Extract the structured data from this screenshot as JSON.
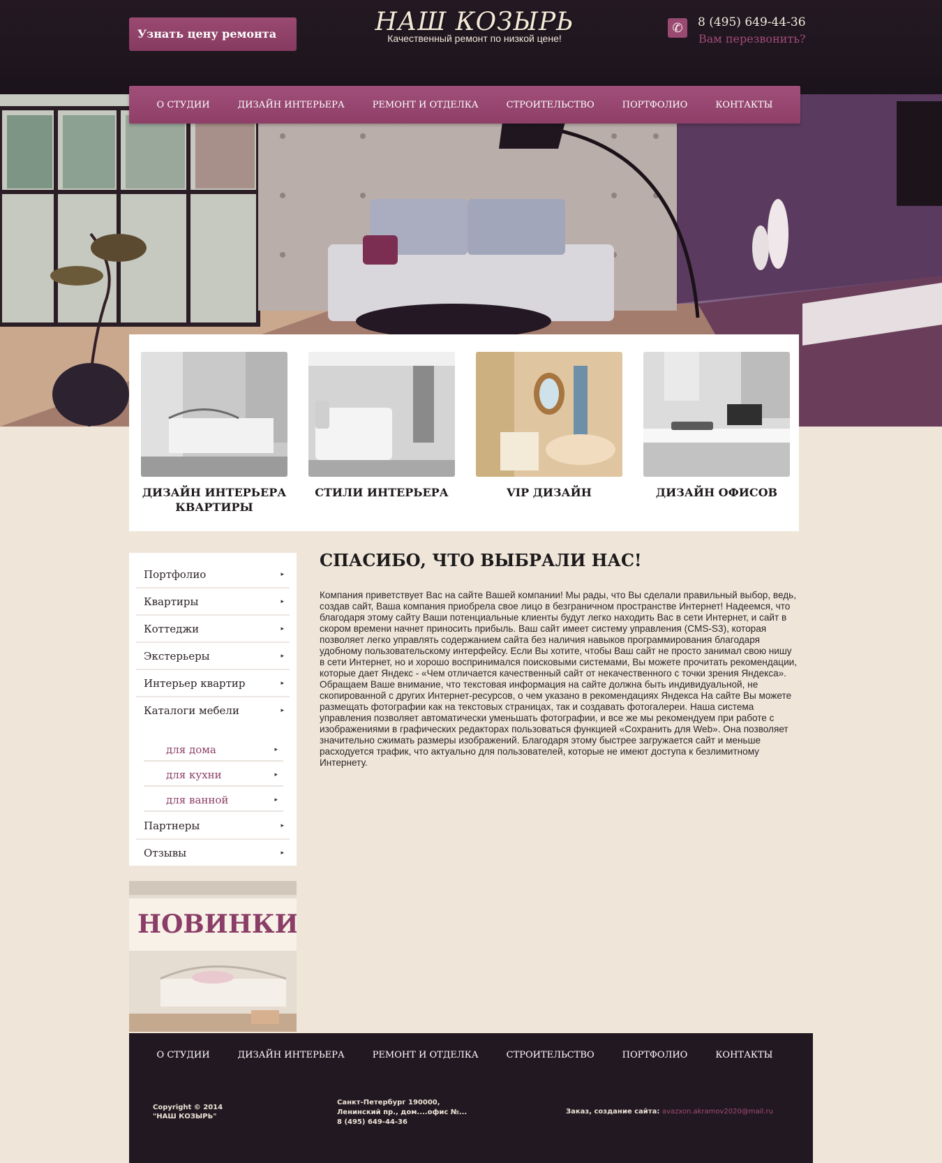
{
  "header": {
    "price_button": "Узнать цену ремонта",
    "logo_title": "НАШ КОЗЫРЬ",
    "logo_tagline": "Качественный ремонт по низкой цене!",
    "phone": "8 (495) 649-44-36",
    "callback": "Вам перезвонить?"
  },
  "nav": {
    "items": [
      "О СТУДИИ",
      "ДИЗАЙН ИНТЕРЬЕРА",
      "РЕМОНТ И ОТДЕЛКА",
      "СТРОИТЕЛЬСТВО",
      "ПОРТФОЛИО",
      "КОНТАКТЫ"
    ]
  },
  "cards": [
    {
      "title": "ДИЗАЙН ИНТЕРЬЕРА КВАРТИРЫ"
    },
    {
      "title": "СТИЛИ ИНТЕРЬЕРА"
    },
    {
      "title": "VIP ДИЗАЙН"
    },
    {
      "title": "ДИЗАЙН ОФИСОВ"
    }
  ],
  "sidebar": {
    "items": [
      "Портфолио",
      "Квартиры",
      "Коттеджи",
      "Экстерьеры",
      "Интерьер квартир",
      "Каталоги мебели"
    ],
    "subitems": [
      "для дома",
      "для кухни",
      "для ванной"
    ],
    "items_after": [
      "Партнеры",
      "Отзывы"
    ],
    "arrow": "▸"
  },
  "news": {
    "label": "НОВИНКИ"
  },
  "content": {
    "title": "СПАСИБО, ЧТО ВЫБРАЛИ НАС!",
    "body": "Компания приветствует Вас на сайте Вашей компании! Мы рады, что Вы сделали правильный выбор, ведь, создав сайт, Ваша компания приобрела свое лицо в безграничном пространстве Интернет! Надеемся, что благодаря этому сайту Ваши потенциальные клиенты будут легко находить Вас в сети Интернет, и сайт в скором времени начнет приносить прибыль. Ваш сайт имеет систему управления (CMS-S3), которая позволяет легко управлять содержанием сайта без наличия навыков программирования благодаря удобному пользовательскому интерфейсу. Если Вы хотите, чтобы Ваш сайт не просто занимал свою нишу в сети Интернет, но и хорошо воспринимался поисковыми системами, Вы можете прочитать рекомендации, которые дает Яндекс - «Чем отличается качественный сайт от некачественного с точки зрения Яндекса». Обращаем Ваше внимание, что текстовая информация на сайте должна быть индивидуальной, не скопированной с других Интернет-ресурсов, о чем указано в рекомендациях Яндекса На сайте Вы можете размещать фотографии как на текстовых страницах, так и создавать фотогалереи. Наша система управления позволяет автоматически уменьшать фотографии, и все же мы рекомендуем при работе с изображениями в графических редакторах пользоваться функцией «Сохранить для Web». Она позволяет значительно сжимать размеры изображений. Благодаря этому быстрее загружается сайт и меньше расходуется трафик, что актуально для пользователей, которые не имеют доступа к безлимитному Интернету."
  },
  "footer": {
    "copyright_line1": "Copyright © 2014",
    "copyright_line2": "\"НАШ КОЗЫРЬ\"",
    "address_line1": "Санкт-Петербург 190000,",
    "address_line2": "Ленинский пр., дом....офис №...",
    "address_line3": "8 (495) 649-44-36",
    "order_label": "Заказ, создание сайта:",
    "order_email": "avazxon.akramov2020@mail.ru"
  },
  "colors": {
    "accent": "#9a4a71",
    "header_bg": "#1f161f",
    "page_bg": "#efe5d9"
  },
  "icons": {
    "phone": "phone-icon"
  }
}
